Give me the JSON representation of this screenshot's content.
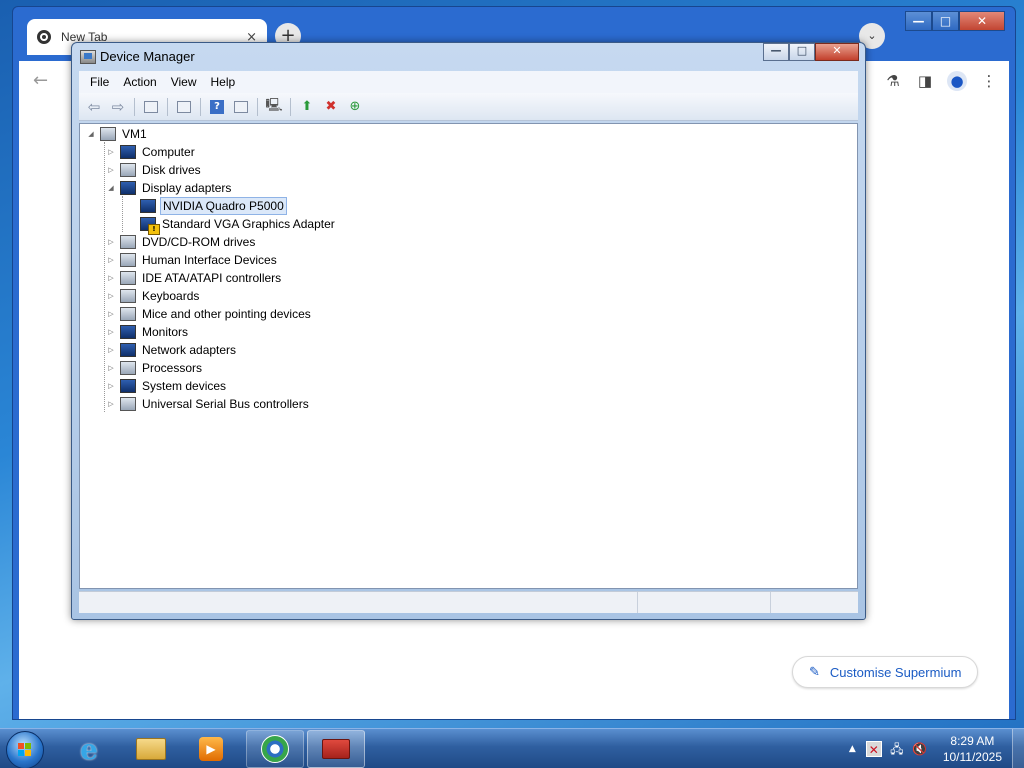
{
  "browser": {
    "tab_title": "New Tab",
    "tab_close": "×",
    "new_tab": "+",
    "tab_search": "⌄",
    "controls": {
      "minimize": "—",
      "maximize": "□",
      "close": "✕"
    },
    "back": "←",
    "customise_label": "Customise Supermium",
    "customise_icon": "pencil-icon"
  },
  "device_manager": {
    "title": "Device Manager",
    "controls": {
      "minimize": "—",
      "maximize": "□",
      "close": "✕"
    },
    "menu": [
      "File",
      "Action",
      "View",
      "Help"
    ],
    "toolbar": [
      "back-icon",
      "forward-icon",
      "show-hide-console-tree-icon",
      "properties-icon",
      "help-icon",
      "action-pane-icon",
      "scan-hardware-icon",
      "update-driver-icon",
      "uninstall-icon",
      "enable-device-icon"
    ],
    "tree": {
      "root": "VM1",
      "categories": [
        {
          "label": "Computer",
          "icon": "computer-icon",
          "expanded": false
        },
        {
          "label": "Disk drives",
          "icon": "disk-drive-icon",
          "expanded": false
        },
        {
          "label": "Display adapters",
          "icon": "display-adapter-icon",
          "expanded": true,
          "children": [
            {
              "label": "NVIDIA Quadro P5000",
              "icon": "display-adapter-icon",
              "selected": true,
              "warning": false
            },
            {
              "label": "Standard VGA Graphics Adapter",
              "icon": "display-adapter-warning-icon",
              "selected": false,
              "warning": true
            }
          ]
        },
        {
          "label": "DVD/CD-ROM drives",
          "icon": "dvd-drive-icon",
          "expanded": false
        },
        {
          "label": "Human Interface Devices",
          "icon": "hid-icon",
          "expanded": false
        },
        {
          "label": "IDE ATA/ATAPI controllers",
          "icon": "ide-controller-icon",
          "expanded": false
        },
        {
          "label": "Keyboards",
          "icon": "keyboard-icon",
          "expanded": false
        },
        {
          "label": "Mice and other pointing devices",
          "icon": "mouse-icon",
          "expanded": false
        },
        {
          "label": "Monitors",
          "icon": "monitor-icon",
          "expanded": false
        },
        {
          "label": "Network adapters",
          "icon": "network-adapter-icon",
          "expanded": false
        },
        {
          "label": "Processors",
          "icon": "processor-icon",
          "expanded": false
        },
        {
          "label": "System devices",
          "icon": "system-devices-icon",
          "expanded": false
        },
        {
          "label": "Universal Serial Bus controllers",
          "icon": "usb-icon",
          "expanded": false
        }
      ]
    }
  },
  "taskbar": {
    "apps": [
      "internet-explorer-icon",
      "file-explorer-icon",
      "media-player-icon",
      "supermium-icon",
      "device-manager-icon"
    ],
    "tray_expand": "▲",
    "time": "8:29 AM",
    "date": "10/11/2025"
  },
  "colors": {
    "selection_bg": "#dbe8f9",
    "selection_border": "#8fb3e6",
    "link_blue": "#1a5bc4",
    "warning_yellow": "#f4c20d"
  }
}
